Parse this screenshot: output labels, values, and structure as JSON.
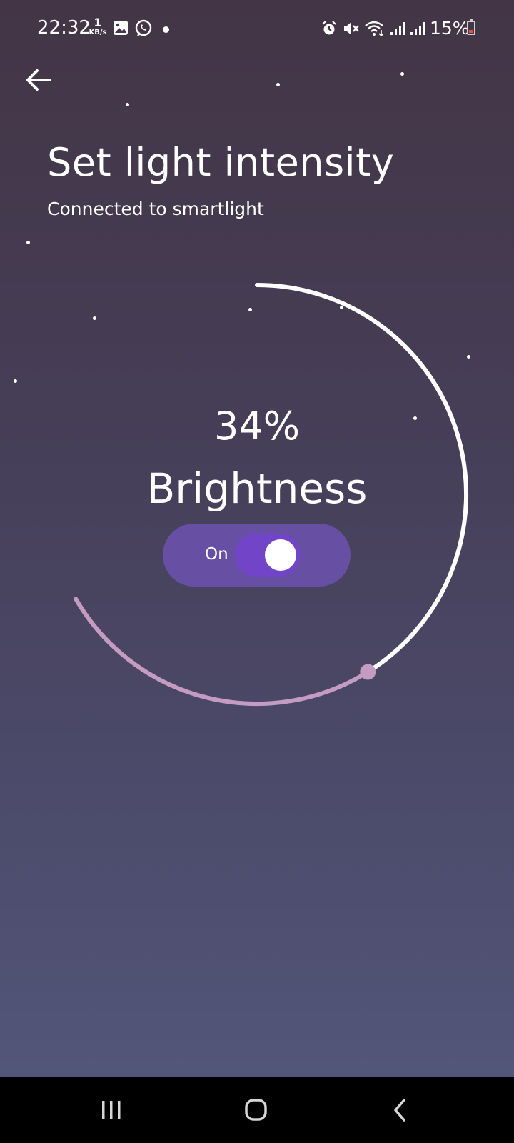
{
  "status_bar": {
    "time": "22:32",
    "net_speed_value": "1",
    "net_speed_unit": "KB/s",
    "battery_percent": "15%",
    "icons": [
      "gallery-icon",
      "whatsapp-icon",
      "notification-dot",
      "alarm-icon",
      "mute-icon",
      "wifi-icon",
      "signal-icon",
      "signal-icon",
      "battery-icon"
    ]
  },
  "header": {
    "back_icon": "arrow-left-icon",
    "title": "Set light intensity",
    "subtitle": "Connected to smartlight"
  },
  "brightness": {
    "percent_text": "34%",
    "level": 0.34,
    "label": "Brightness"
  },
  "power_toggle": {
    "label": "On",
    "state": true
  },
  "colors": {
    "arc_active": "#ffffff",
    "arc_inactive": "#c49bc3",
    "toggle_bg": "#6750a4",
    "switch_track": "#7244c7"
  },
  "nav_bar": {
    "icons": [
      "recents-icon",
      "home-icon",
      "back-icon"
    ]
  }
}
